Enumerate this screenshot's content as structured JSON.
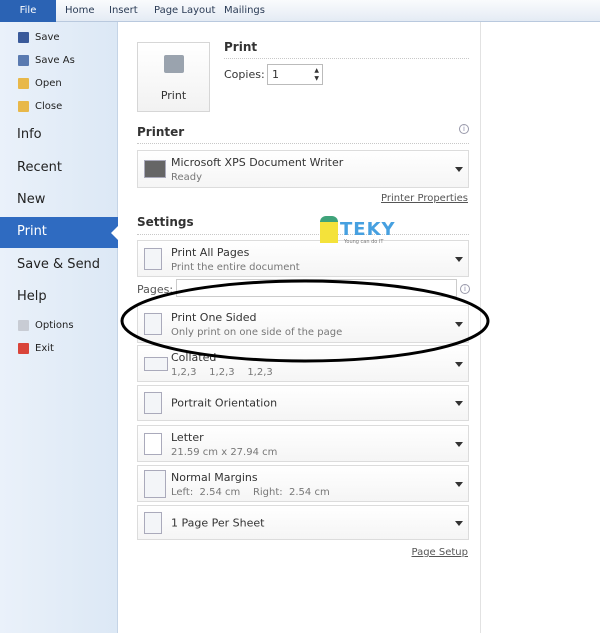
{
  "tabs": [
    "File",
    "Home",
    "Insert",
    "Page Layout",
    "Mailings"
  ],
  "sidebar": {
    "small_top": [
      {
        "label": "Save",
        "icon": "save-icon"
      },
      {
        "label": "Save As",
        "icon": "save-as-icon"
      },
      {
        "label": "Open",
        "icon": "open-folder-icon"
      },
      {
        "label": "Close",
        "icon": "close-folder-icon"
      }
    ],
    "big": [
      "Info",
      "Recent",
      "New",
      "Print",
      "Save & Send",
      "Help"
    ],
    "selected": "Print",
    "small_bottom": [
      {
        "label": "Options",
        "icon": "options-icon"
      },
      {
        "label": "Exit",
        "icon": "exit-icon"
      }
    ]
  },
  "print": {
    "heading": "Print",
    "button": "Print",
    "copies_label": "Copies:",
    "copies": "1"
  },
  "printer": {
    "heading": "Printer",
    "name": "Microsoft XPS Document Writer",
    "status": "Ready",
    "properties_link": "Printer Properties"
  },
  "settings": {
    "heading": "Settings",
    "pages_label": "Pages:",
    "pages_value": "",
    "options": [
      {
        "title": "Print All Pages",
        "sub": "Print the entire document"
      },
      {
        "title": "Print One Sided",
        "sub": "Only print on one side of the page"
      },
      {
        "title": "Collated",
        "sub": "1,2,3    1,2,3    1,2,3"
      },
      {
        "title": "Portrait Orientation",
        "sub": ""
      },
      {
        "title": "Letter",
        "sub": "21.59 cm x 27.94 cm"
      },
      {
        "title": "Normal Margins",
        "sub": "Left:  2.54 cm    Right:  2.54 cm"
      },
      {
        "title": "1 Page Per Sheet",
        "sub": ""
      }
    ],
    "page_setup_link": "Page Setup"
  },
  "watermark": {
    "text": "TEKY",
    "tagline": "Young can do IT"
  },
  "colors": {
    "accent": "#2f6bc1",
    "annotation": "#000000"
  }
}
